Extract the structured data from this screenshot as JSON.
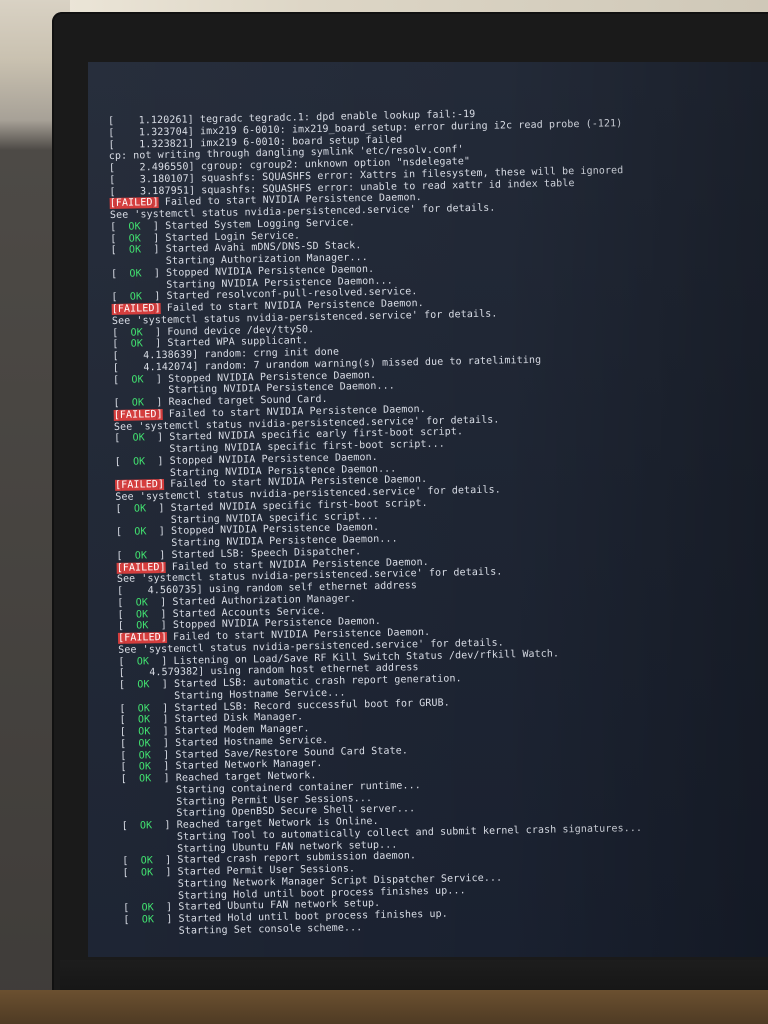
{
  "console": {
    "lines": [
      {
        "type": "plain",
        "text": "[    1.120261] tegradc tegradc.1: dpd enable lookup fail:-19"
      },
      {
        "type": "plain",
        "text": "[    1.323704] imx219 6-0010: imx219_board_setup: error during i2c read probe (-121)"
      },
      {
        "type": "plain",
        "text": "[    1.323821] imx219 6-0010: board setup failed"
      },
      {
        "type": "plain",
        "text": "cp: not writing through dangling symlink 'etc/resolv.conf'"
      },
      {
        "type": "plain",
        "text": "[    2.496550] cgroup: cgroup2: unknown option \"nsdelegate\""
      },
      {
        "type": "plain",
        "text": "[    3.180107] squashfs: SQUASHFS error: Xattrs in filesystem, these will be ignored"
      },
      {
        "type": "plain",
        "text": "[    3.187951] squashfs: SQUASHFS error: unable to read xattr id index table"
      },
      {
        "type": "failed",
        "text": " Failed to start NVIDIA Persistence Daemon."
      },
      {
        "type": "plain",
        "text": "See 'systemctl status nvidia-persistenced.service' for details."
      },
      {
        "type": "ok",
        "text": " Started System Logging Service."
      },
      {
        "type": "ok",
        "text": " Started Login Service."
      },
      {
        "type": "ok",
        "text": " Started Avahi mDNS/DNS-SD Stack."
      },
      {
        "type": "indent",
        "text": "         Starting Authorization Manager..."
      },
      {
        "type": "ok",
        "text": " Stopped NVIDIA Persistence Daemon."
      },
      {
        "type": "indent",
        "text": "         Starting NVIDIA Persistence Daemon..."
      },
      {
        "type": "ok",
        "text": " Started resolvconf-pull-resolved.service."
      },
      {
        "type": "failed",
        "text": " Failed to start NVIDIA Persistence Daemon."
      },
      {
        "type": "plain",
        "text": "See 'systemctl status nvidia-persistenced.service' for details."
      },
      {
        "type": "ok",
        "text": " Found device /dev/ttyS0."
      },
      {
        "type": "ok",
        "text": " Started WPA supplicant."
      },
      {
        "type": "plain",
        "text": "[    4.138639] random: crng init done"
      },
      {
        "type": "plain",
        "text": "[    4.142074] random: 7 urandom warning(s) missed due to ratelimiting"
      },
      {
        "type": "ok",
        "text": " Stopped NVIDIA Persistence Daemon."
      },
      {
        "type": "indent",
        "text": "         Starting NVIDIA Persistence Daemon..."
      },
      {
        "type": "ok",
        "text": " Reached target Sound Card."
      },
      {
        "type": "failed",
        "text": " Failed to start NVIDIA Persistence Daemon."
      },
      {
        "type": "plain",
        "text": "See 'systemctl status nvidia-persistenced.service' for details."
      },
      {
        "type": "ok",
        "text": " Started NVIDIA specific early first-boot script."
      },
      {
        "type": "indent",
        "text": "         Starting NVIDIA specific first-boot script..."
      },
      {
        "type": "ok",
        "text": " Stopped NVIDIA Persistence Daemon."
      },
      {
        "type": "indent",
        "text": "         Starting NVIDIA Persistence Daemon..."
      },
      {
        "type": "failed",
        "text": " Failed to start NVIDIA Persistence Daemon."
      },
      {
        "type": "plain",
        "text": "See 'systemctl status nvidia-persistenced.service' for details."
      },
      {
        "type": "ok",
        "text": " Started NVIDIA specific first-boot script."
      },
      {
        "type": "indent",
        "text": "         Starting NVIDIA specific script..."
      },
      {
        "type": "ok",
        "text": " Stopped NVIDIA Persistence Daemon."
      },
      {
        "type": "indent",
        "text": "         Starting NVIDIA Persistence Daemon..."
      },
      {
        "type": "ok",
        "text": " Started LSB: Speech Dispatcher."
      },
      {
        "type": "failed",
        "text": " Failed to start NVIDIA Persistence Daemon."
      },
      {
        "type": "plain",
        "text": "See 'systemctl status nvidia-persistenced.service' for details."
      },
      {
        "type": "plain",
        "text": "[    4.560735] using random self ethernet address"
      },
      {
        "type": "ok",
        "text": " Started Authorization Manager."
      },
      {
        "type": "ok",
        "text": " Started Accounts Service."
      },
      {
        "type": "ok",
        "text": " Stopped NVIDIA Persistence Daemon."
      },
      {
        "type": "failed",
        "text": " Failed to start NVIDIA Persistence Daemon."
      },
      {
        "type": "plain",
        "text": "See 'systemctl status nvidia-persistenced.service' for details."
      },
      {
        "type": "ok",
        "text": " Listening on Load/Save RF Kill Switch Status /dev/rfkill Watch."
      },
      {
        "type": "plain",
        "text": "[    4.579382] using random host ethernet address"
      },
      {
        "type": "ok",
        "text": " Started LSB: automatic crash report generation."
      },
      {
        "type": "indent",
        "text": "         Starting Hostname Service..."
      },
      {
        "type": "ok",
        "text": " Started LSB: Record successful boot for GRUB."
      },
      {
        "type": "ok",
        "text": " Started Disk Manager."
      },
      {
        "type": "ok",
        "text": " Started Modem Manager."
      },
      {
        "type": "ok",
        "text": " Started Hostname Service."
      },
      {
        "type": "ok",
        "text": " Started Save/Restore Sound Card State."
      },
      {
        "type": "ok",
        "text": " Started Network Manager."
      },
      {
        "type": "ok",
        "text": " Reached target Network."
      },
      {
        "type": "indent",
        "text": "         Starting containerd container runtime..."
      },
      {
        "type": "indent",
        "text": "         Starting Permit User Sessions..."
      },
      {
        "type": "indent",
        "text": "         Starting OpenBSD Secure Shell server..."
      },
      {
        "type": "ok",
        "text": " Reached target Network is Online."
      },
      {
        "type": "indent",
        "text": "         Starting Tool to automatically collect and submit kernel crash signatures..."
      },
      {
        "type": "indent",
        "text": "         Starting Ubuntu FAN network setup..."
      },
      {
        "type": "ok",
        "text": " Started crash report submission daemon."
      },
      {
        "type": "ok",
        "text": " Started Permit User Sessions."
      },
      {
        "type": "indent",
        "text": "         Starting Network Manager Script Dispatcher Service..."
      },
      {
        "type": "indent",
        "text": "         Starting Hold until boot process finishes up..."
      },
      {
        "type": "ok",
        "text": " Started Ubuntu FAN network setup."
      },
      {
        "type": "ok",
        "text": " Started Hold until boot process finishes up."
      },
      {
        "type": "indent",
        "text": "         Starting Set console scheme..."
      }
    ],
    "ok_tag": "  OK  ",
    "failed_tag": "FAILED",
    "colors": {
      "ok": "#3ee06d",
      "failed_bg": "#d33a3a",
      "text": "#d9dde6",
      "screen": "#1e2533"
    }
  }
}
